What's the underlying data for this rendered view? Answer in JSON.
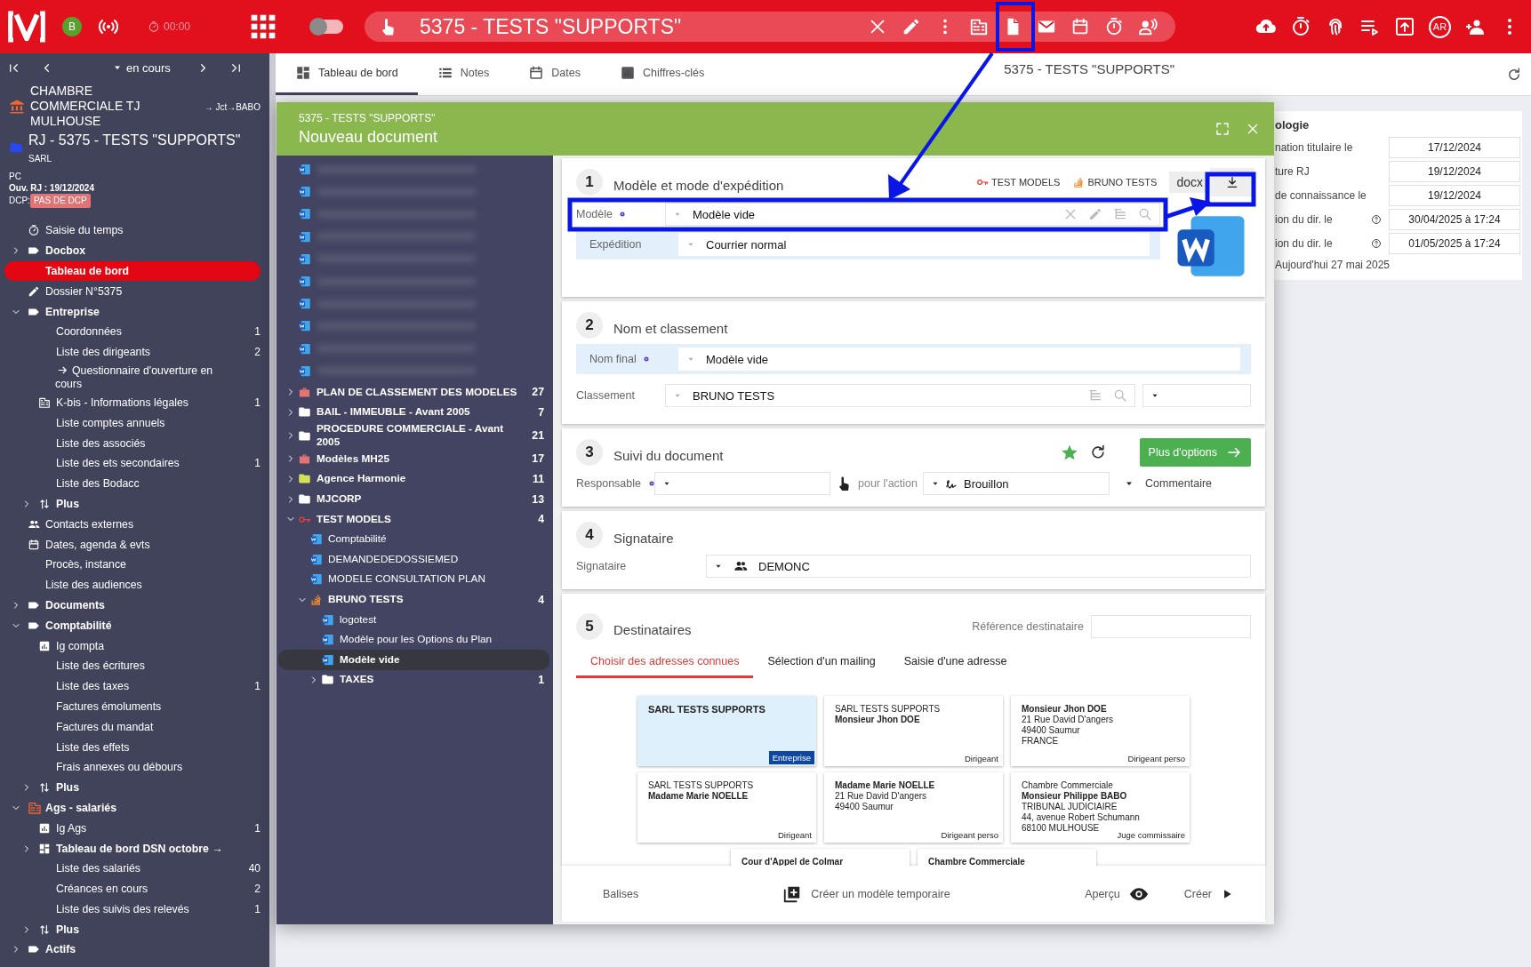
{
  "topbar": {
    "avatar": "B",
    "timer": "00:00",
    "toggle_on": false,
    "file_title": "5375 - TESTS \"SUPPORTS\"",
    "user": "AR"
  },
  "sidebar": {
    "period": "en cours",
    "court": "CHAMBRE COMMERCIALE TJ MULHOUSE",
    "court_link": "→ Jct→BABO",
    "case_title": "RJ - 5375 - TESTS \"SUPPORTS\"",
    "case_form": "SARL",
    "procedure": "PC",
    "opening": "Ouv. RJ : 19/12/2024",
    "dcp_label": "DCP:",
    "dcp_badge": "PAS DE DCP",
    "nav": [
      {
        "kind": "timer",
        "label": "Saisie du temps",
        "selected": false
      },
      {
        "kind": "group",
        "label": "Docbox",
        "expanded": false,
        "selected": false
      },
      {
        "kind": "plain",
        "label": "Tableau de bord",
        "selected": true
      },
      {
        "kind": "edit",
        "label": "Dossier N°5375",
        "selected": false
      },
      {
        "kind": "group",
        "label": "Entreprise",
        "expanded": true,
        "selected": false,
        "children": [
          {
            "kind": "plain",
            "label": "Coordonnées",
            "count": "1",
            "selected": false
          },
          {
            "kind": "plain",
            "label": "Liste des dirigeants",
            "count": "2",
            "selected": false
          },
          {
            "kind": "link",
            "label": "Questionnaire d'ouverture en cours",
            "selected": false
          },
          {
            "kind": "company",
            "label": "K-bis - Informations légales",
            "count": "1",
            "selected": false
          },
          {
            "kind": "plain",
            "label": "Liste comptes annuels",
            "selected": false
          },
          {
            "kind": "plain",
            "label": "Liste des associés",
            "selected": false
          },
          {
            "kind": "plain",
            "label": "Liste des ets secondaires",
            "count": "1",
            "selected": false
          },
          {
            "kind": "plain",
            "label": "Liste des Bodacc",
            "selected": false
          },
          {
            "kind": "more",
            "label": "Plus",
            "expanded": false,
            "selected": false
          }
        ]
      },
      {
        "kind": "contacts",
        "label": "Contacts externes",
        "selected": false
      },
      {
        "kind": "calendar",
        "label": "Dates, agenda & evts",
        "selected": false
      },
      {
        "kind": "plain",
        "label": "Procès, instance",
        "selected": false
      },
      {
        "kind": "plain",
        "label": "Liste des audiences",
        "selected": false
      },
      {
        "kind": "group",
        "label": "Documents",
        "expanded": false,
        "selected": false
      },
      {
        "kind": "group",
        "label": "Comptabilité",
        "expanded": true,
        "selected": false,
        "children": [
          {
            "kind": "stats",
            "label": "Ig compta",
            "selected": false
          },
          {
            "kind": "plain",
            "label": "Liste des écritures",
            "selected": false
          },
          {
            "kind": "plain",
            "label": "Liste des taxes",
            "count": "1",
            "selected": false
          },
          {
            "kind": "plain",
            "label": "Factures émoluments",
            "selected": false
          },
          {
            "kind": "plain",
            "label": "Factures du mandat",
            "selected": false
          },
          {
            "kind": "plain",
            "label": "Liste des effets",
            "selected": false
          },
          {
            "kind": "plain",
            "label": "Frais annexes ou débours",
            "selected": false
          },
          {
            "kind": "more",
            "label": "Plus",
            "expanded": false,
            "selected": false
          }
        ]
      },
      {
        "kind": "org",
        "label": "Ags - salariés",
        "expanded": true,
        "selected": false,
        "children": [
          {
            "kind": "stats",
            "label": "Ig Ags",
            "count": "1",
            "selected": false
          },
          {
            "kind": "dashboard",
            "label": "Tableau de bord DSN octobre →",
            "expanded": false,
            "selected": false
          },
          {
            "kind": "plain",
            "label": "Liste des salariés",
            "count": "40",
            "selected": false
          },
          {
            "kind": "plain",
            "label": "Créances en cours",
            "count": "2",
            "selected": false
          },
          {
            "kind": "plain",
            "label": "Liste des suivis des relevés",
            "count": "1",
            "selected": false
          },
          {
            "kind": "more",
            "label": "Plus",
            "expanded": false,
            "selected": false
          }
        ]
      },
      {
        "kind": "group",
        "label": "Actifs",
        "expanded": false,
        "selected": false
      }
    ]
  },
  "tabs": [
    {
      "kind": "dashboard",
      "label": "Tableau de bord",
      "selected": true
    },
    {
      "kind": "notes",
      "label": "Notes",
      "selected": false
    },
    {
      "kind": "calendar",
      "label": "Dates",
      "selected": false
    },
    {
      "kind": "stats",
      "label": "Chiffres-clés",
      "selected": false
    }
  ],
  "page_title": "5375 - TESTS \"SUPPORTS\"",
  "right_panel": {
    "heading": "ologie",
    "rows": [
      {
        "label": "nation titulaire le",
        "value": "17/12/2024",
        "help": false
      },
      {
        "label": "ture RJ",
        "value": "19/12/2024",
        "help": false
      },
      {
        "label": "de connaissance le",
        "value": "19/12/2024",
        "help": false
      },
      {
        "label": "ion du dir. le",
        "value": "30/04/2025 à 17:24",
        "help": true
      },
      {
        "label": "ion du dir. le",
        "value": "01/05/2025 à 17:24",
        "help": true
      }
    ],
    "today": "Aujourd'hui 27 mai 2025"
  },
  "modal": {
    "subtitle": "5375 - TESTS \"SUPPORTS\"",
    "title": "Nouveau document",
    "tree": [
      {
        "kind": "redacted",
        "selected": false
      },
      {
        "kind": "redacted",
        "selected": false
      },
      {
        "kind": "redacted",
        "selected": false
      },
      {
        "kind": "redacted",
        "selected": false
      },
      {
        "kind": "redacted",
        "selected": false
      },
      {
        "kind": "redacted",
        "selected": false
      },
      {
        "kind": "redacted",
        "selected": false
      },
      {
        "kind": "redacted",
        "selected": false
      },
      {
        "kind": "redacted",
        "selected": false
      },
      {
        "kind": "redacted",
        "selected": false
      },
      {
        "kind": "case",
        "color": "#e57373",
        "label": "PLAN DE CLASSEMENT DES MODELES",
        "count": "27",
        "expanded": false,
        "selected": false
      },
      {
        "kind": "folder",
        "color": "#ffffff",
        "label": "BAIL - IMMEUBLE - Avant 2005",
        "count": "7",
        "expanded": false,
        "selected": false
      },
      {
        "kind": "folder",
        "color": "#ffffff",
        "label": "PROCEDURE COMMERCIALE - Avant 2005",
        "count": "21",
        "expanded": false,
        "selected": false
      },
      {
        "kind": "case",
        "color": "#e57373",
        "label": "Modèles MH25",
        "count": "17",
        "expanded": false,
        "selected": false
      },
      {
        "kind": "folder",
        "color": "#d4e157",
        "label": "Agence Harmonie",
        "count": "11",
        "expanded": false,
        "selected": false
      },
      {
        "kind": "folder",
        "color": "#ffffff",
        "label": "MJCORP",
        "count": "13",
        "expanded": false,
        "selected": false
      },
      {
        "kind": "key",
        "label": "TEST MODELS",
        "count": "4",
        "expanded": true,
        "selected": false,
        "children": [
          {
            "kind": "doc",
            "label": "Comptabilité",
            "selected": false
          },
          {
            "kind": "doc",
            "label": "DEMANDEDEDOSSIEMED",
            "selected": false
          },
          {
            "kind": "doc",
            "label": "MODELE CONSULTATION PLAN",
            "selected": false
          },
          {
            "kind": "stack",
            "label": "BRUNO TESTS",
            "count": "4",
            "expanded": true,
            "selected": false,
            "children": [
              {
                "kind": "doc",
                "label": "logotest",
                "selected": false
              },
              {
                "kind": "doc",
                "label": "Modèle pour les Options du Plan",
                "selected": false
              },
              {
                "kind": "doc",
                "label": "Modèle vide",
                "selected": true
              },
              {
                "kind": "folder",
                "color": "#ffffff",
                "label": "TAXES",
                "count": "1",
                "expanded": false,
                "selected": false
              }
            ]
          }
        ]
      }
    ],
    "sections": [
      {
        "kind": "model",
        "number": "1",
        "title": "Modèle et mode d'expédition",
        "tags": [
          {
            "kind": "key",
            "label": "TEST MODELS"
          },
          {
            "kind": "stack",
            "label": "BRUNO TESTS"
          }
        ],
        "format": "docx",
        "fields": [
          {
            "label": "Modèle",
            "info": true,
            "value": "Modèle vide",
            "highlight": false
          },
          {
            "label": "Expédition",
            "info": false,
            "value": "Courrier normal",
            "highlight": true
          }
        ]
      },
      {
        "kind": "naming",
        "number": "2",
        "title": "Nom et classement",
        "fields": [
          {
            "label": "Nom final",
            "info": true,
            "value": "Modèle vide",
            "highlight": true
          },
          {
            "label": "Classement",
            "info": false,
            "value": "BRUNO TESTS",
            "highlight": false
          }
        ]
      },
      {
        "kind": "tracking",
        "number": "3",
        "title": "Suivi du document",
        "favorite": true,
        "button": "Plus d'options",
        "responsable_label": "Responsable",
        "responsable_info": true,
        "action_label": "pour l'action",
        "action_value": "Brouillon",
        "comment": "Commentaire"
      },
      {
        "kind": "signer",
        "number": "4",
        "title": "Signataire",
        "label": "Signataire",
        "value": "DEMONC"
      },
      {
        "kind": "recipients",
        "number": "5",
        "title": "Destinataires",
        "reference_label": "Référence destinataire",
        "tabs": [
          {
            "label": "Choisir des adresses connues",
            "selected": true
          },
          {
            "label": "Sélection d'un mailing",
            "selected": false
          },
          {
            "label": "Saisie d'une adresse",
            "selected": false
          }
        ],
        "addresses": [
          {
            "lines": [
              {
                "text": "SARL TESTS SUPPORTS",
                "bold": true
              }
            ],
            "role": "Entreprise",
            "selected": true
          },
          {
            "lines": [
              {
                "text": "SARL TESTS SUPPORTS",
                "bold": false
              },
              {
                "text": "Monsieur Jhon DOE",
                "bold": true
              }
            ],
            "role": "Dirigeant",
            "selected": false
          },
          {
            "lines": [
              {
                "text": "Monsieur Jhon DOE",
                "bold": true
              },
              {
                "text": "21 Rue David D'angers",
                "bold": false
              },
              {
                "text": "49400 Saumur",
                "bold": false
              },
              {
                "text": "FRANCE",
                "bold": false
              }
            ],
            "role": "Dirigeant perso",
            "selected": false
          },
          {
            "lines": [
              {
                "text": "SARL TESTS SUPPORTS",
                "bold": false
              },
              {
                "text": "Madame Marie NOELLE",
                "bold": true
              }
            ],
            "role": "Dirigeant",
            "selected": false
          },
          {
            "lines": [
              {
                "text": "Madame Marie NOELLE",
                "bold": true
              },
              {
                "text": "21 Rue David D'angers",
                "bold": false
              },
              {
                "text": "49400 Saumur",
                "bold": false
              }
            ],
            "role": "Dirigeant perso",
            "selected": false
          },
          {
            "lines": [
              {
                "text": "Chambre Commerciale",
                "bold": false
              },
              {
                "text": "Monsieur Philippe BABO",
                "bold": true
              },
              {
                "text": "TRIBUNAL JUDICIAIRE",
                "bold": false
              },
              {
                "text": "44, avenue Robert Schumann",
                "bold": false
              },
              {
                "text": "68100 MULHOUSE",
                "bold": false
              }
            ],
            "role": "Juge commissaire",
            "selected": false
          },
          {
            "lines": [
              {
                "text": "Cour d'Appel de Colmar",
                "bold": true
              }
            ],
            "selected": false
          },
          {
            "lines": [
              {
                "text": "Chambre Commerciale",
                "bold": true
              }
            ],
            "selected": false
          }
        ]
      }
    ],
    "footer": {
      "tags": "Balises",
      "temp_model": "Créer un modèle temporaire",
      "preview": "Aperçu",
      "create": "Créer"
    }
  }
}
